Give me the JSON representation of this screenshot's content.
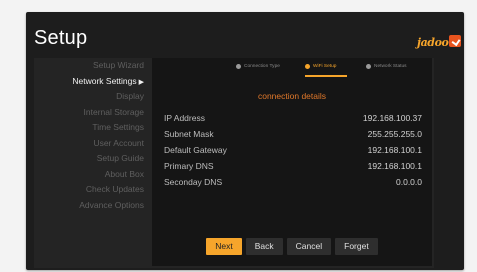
{
  "header": {
    "title": "Setup",
    "brand": "jadoo"
  },
  "sidebar": {
    "items": [
      {
        "label": "Setup Wizard",
        "active": false
      },
      {
        "label": "Network Settings",
        "active": true
      },
      {
        "label": "Display",
        "active": false
      },
      {
        "label": "Internal Storage",
        "active": false
      },
      {
        "label": "Time Settings",
        "active": false
      },
      {
        "label": "User Account",
        "active": false
      },
      {
        "label": "Setup Guide",
        "active": false
      },
      {
        "label": "About Box",
        "active": false
      },
      {
        "label": "Check Updates",
        "active": false
      },
      {
        "label": "Advance Options",
        "active": false
      }
    ]
  },
  "steps": [
    {
      "label": "Connection Type",
      "state": "done"
    },
    {
      "label": "WiFi Setup",
      "state": "current"
    },
    {
      "label": "Network Status",
      "state": "todo"
    }
  ],
  "details": {
    "title": "connection details",
    "rows": [
      {
        "label": "IP Address",
        "value": "192.168.100.37"
      },
      {
        "label": "Subnet Mask",
        "value": "255.255.255.0"
      },
      {
        "label": "Default Gateway",
        "value": "192.168.100.1"
      },
      {
        "label": "Primary DNS",
        "value": "192.168.100.1"
      },
      {
        "label": "Seconday DNS",
        "value": "0.0.0.0"
      }
    ]
  },
  "buttons": {
    "next": "Next",
    "back": "Back",
    "cancel": "Cancel",
    "forget": "Forget"
  },
  "colors": {
    "accent": "#f6a52b",
    "section_title": "#e0782a",
    "logo_box": "#e8541e"
  }
}
